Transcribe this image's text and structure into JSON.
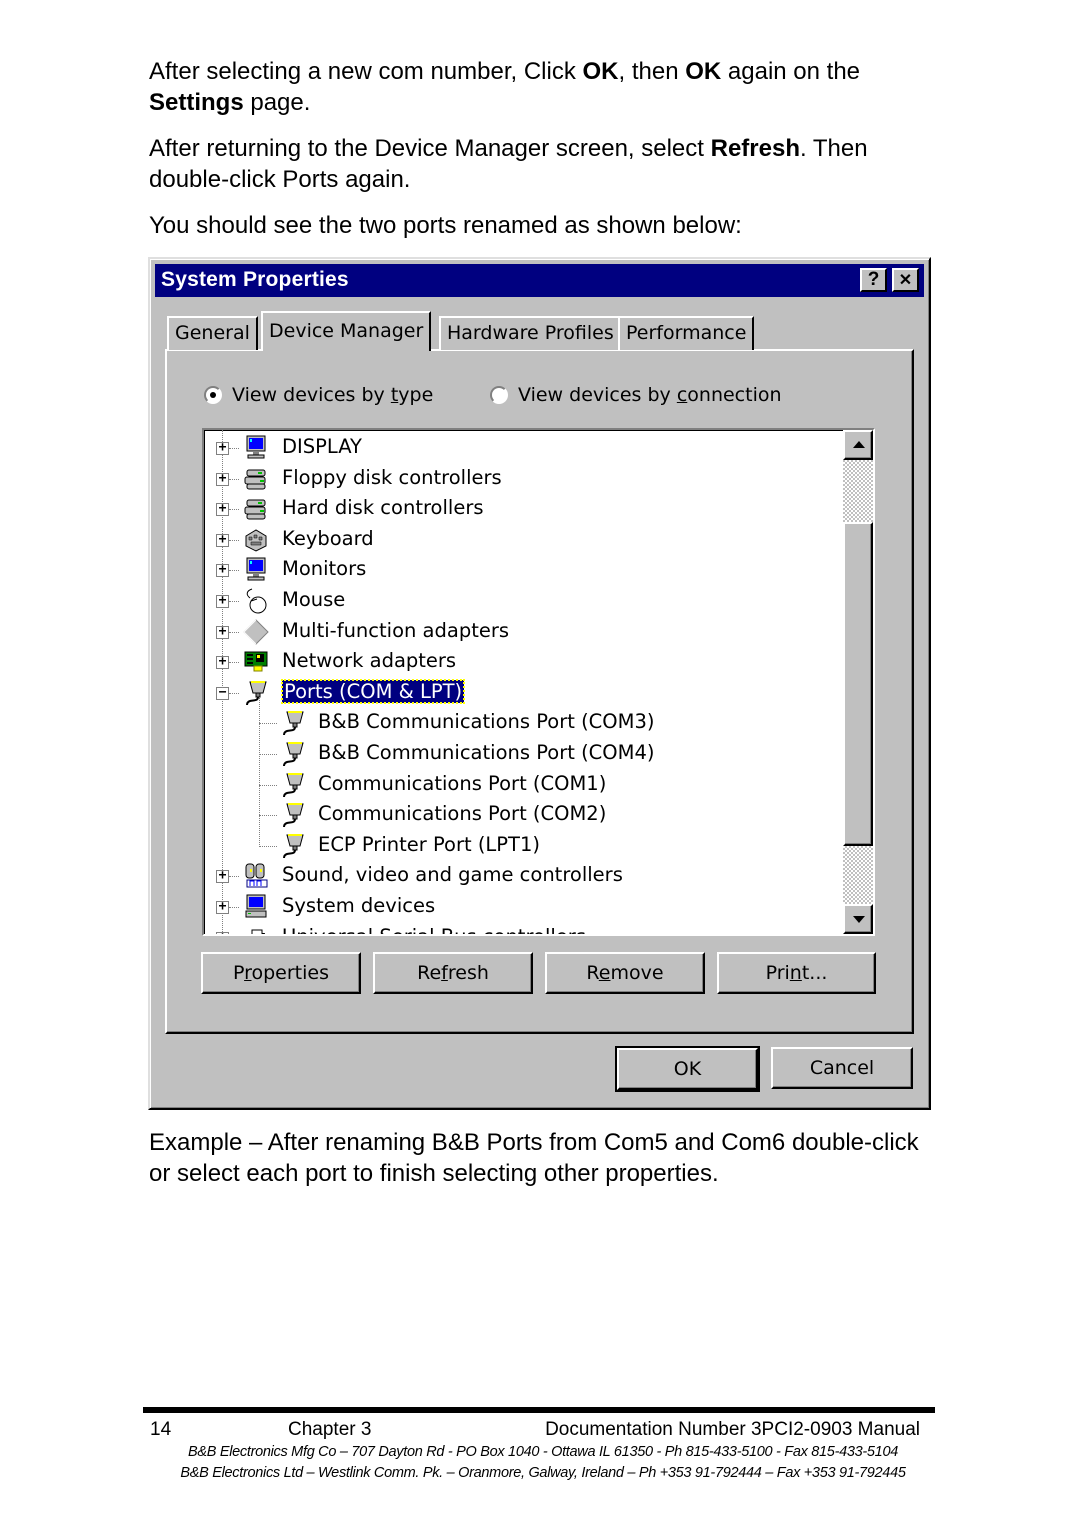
{
  "document": {
    "paragraphs": [
      {
        "parts": [
          {
            "t": "After selecting a new com number, Click ",
            "b": false
          },
          {
            "t": "OK",
            "b": true
          },
          {
            "t": ", then ",
            "b": false
          },
          {
            "t": "OK",
            "b": true
          },
          {
            "t": " again on the ",
            "b": false
          },
          {
            "t": "Settings",
            "b": true
          },
          {
            "t": " page.",
            "b": false
          }
        ]
      },
      {
        "parts": [
          {
            "t": "After returning to the Device Manager screen, select ",
            "b": false
          },
          {
            "t": "Refresh",
            "b": true
          },
          {
            "t": ". Then double-click Ports again.",
            "b": false
          }
        ]
      },
      {
        "parts": [
          {
            "t": "You should see the two ports renamed as shown below:",
            "b": false
          }
        ]
      },
      {
        "parts": [
          {
            "t": "Example – After renaming B&B Ports from Com5 and Com6 double-click or select each port to finish selecting other properties.",
            "b": false
          }
        ]
      }
    ]
  },
  "dialog": {
    "title": "System Properties",
    "help_label": "?",
    "close_label": "✕",
    "colors": {
      "titlebar": "#000080",
      "face": "#c0c0c0",
      "selection": "#000080"
    },
    "tabs": [
      {
        "label": "General",
        "active": false
      },
      {
        "label": "Device Manager",
        "active": true
      },
      {
        "label": "Hardware Profiles",
        "active": false
      },
      {
        "label": "Performance",
        "active": false
      }
    ],
    "view_options": {
      "by_type": {
        "pre": "View devices by ",
        "mn": "t",
        "post": "ype",
        "selected": true
      },
      "by_connection": {
        "pre": "View devices by ",
        "mn": "c",
        "post": "onnection",
        "selected": false
      }
    },
    "tree": [
      {
        "label": "DISPLAY",
        "icon": "monitor-icon",
        "level": 0,
        "expander": "+"
      },
      {
        "label": "Floppy disk controllers",
        "icon": "disk-controller-icon",
        "level": 0,
        "expander": "+"
      },
      {
        "label": "Hard disk controllers",
        "icon": "disk-controller-icon",
        "level": 0,
        "expander": "+"
      },
      {
        "label": "Keyboard",
        "icon": "keyboard-icon",
        "level": 0,
        "expander": "+"
      },
      {
        "label": "Monitors",
        "icon": "monitor-icon",
        "level": 0,
        "expander": "+"
      },
      {
        "label": "Mouse",
        "icon": "mouse-icon",
        "level": 0,
        "expander": "+"
      },
      {
        "label": "Multi-function adapters",
        "icon": "diamond-icon",
        "level": 0,
        "expander": "+"
      },
      {
        "label": "Network adapters",
        "icon": "network-card-icon",
        "level": 0,
        "expander": "+"
      },
      {
        "label": "Ports (COM & LPT)",
        "icon": "port-icon",
        "level": 0,
        "expander": "−",
        "selected": true
      },
      {
        "label": "B&B Communications Port (COM3)",
        "icon": "port-icon",
        "level": 1
      },
      {
        "label": "B&B Communications Port (COM4)",
        "icon": "port-icon",
        "level": 1
      },
      {
        "label": "Communications Port (COM1)",
        "icon": "port-icon",
        "level": 1
      },
      {
        "label": "Communications Port (COM2)",
        "icon": "port-icon",
        "level": 1
      },
      {
        "label": "ECP Printer Port (LPT1)",
        "icon": "port-icon",
        "level": 1
      },
      {
        "label": "Sound, video and game controllers",
        "icon": "sound-icon",
        "level": 0,
        "expander": "+"
      },
      {
        "label": "System devices",
        "icon": "computer-icon",
        "level": 0,
        "expander": "+"
      },
      {
        "label": "Universal Serial Bus controllers",
        "icon": "usb-icon",
        "level": 0,
        "expander": "+"
      }
    ],
    "scrollbar": {
      "thumb_position_fraction": 0.14,
      "visible_fraction": 0.73
    },
    "action_buttons": [
      {
        "pre": "P",
        "mn": "r",
        "post": "operties"
      },
      {
        "pre": "Re",
        "mn": "f",
        "post": "resh"
      },
      {
        "pre": "R",
        "mn": "e",
        "post": "move"
      },
      {
        "pre": "Pri",
        "mn": "n",
        "post": "t..."
      }
    ],
    "ok_label": "OK",
    "cancel_label": "Cancel"
  },
  "footer": {
    "page_number": "14",
    "chapter": "Chapter 3",
    "doc_number": "Documentation Number 3PCI2-0903 Manual",
    "address_us": "B&B Electronics Mfg Co – 707 Dayton Rd - PO Box 1040 - Ottawa IL 61350 - Ph 815-433-5100 - Fax 815-433-5104",
    "address_ie": "B&B Electronics Ltd – Westlink Comm. Pk. – Oranmore, Galway, Ireland – Ph +353 91-792444 – Fax +353 91-792445"
  }
}
